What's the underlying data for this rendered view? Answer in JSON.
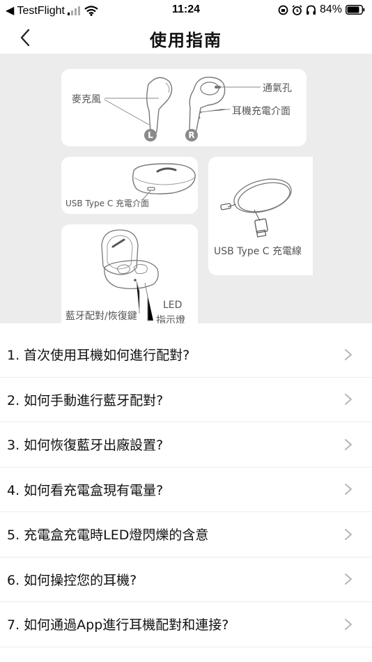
{
  "status_bar": {
    "back_app": "◀ TestFlight",
    "time": "11:24",
    "battery_percent": "84%"
  },
  "header": {
    "title": "使用指南"
  },
  "diagram": {
    "mic_label": "麥克風",
    "vent_label": "通氣孔",
    "charge_port_label": "耳機充電介面",
    "left_mark": "L",
    "right_mark": "R",
    "case_port_label": "USB Type C 充電介面",
    "cable_label": "USB Type C 充電線",
    "reset_button_label": "藍牙配對/恢復鍵",
    "led_label_line1": "LED",
    "led_label_line2": "指示燈"
  },
  "faq": [
    {
      "label": "1. 首次使用耳機如何進行配對?"
    },
    {
      "label": "2. 如何手動進行藍牙配對?"
    },
    {
      "label": "3. 如何恢復藍牙出廠設置?"
    },
    {
      "label": "4. 如何看充電盒現有電量?"
    },
    {
      "label": "5. 充電盒充電時LED燈閃爍的含意"
    },
    {
      "label": "6. 如何操控您的耳機?"
    },
    {
      "label": "7. 如何通過App進行耳機配對和連接?"
    }
  ]
}
